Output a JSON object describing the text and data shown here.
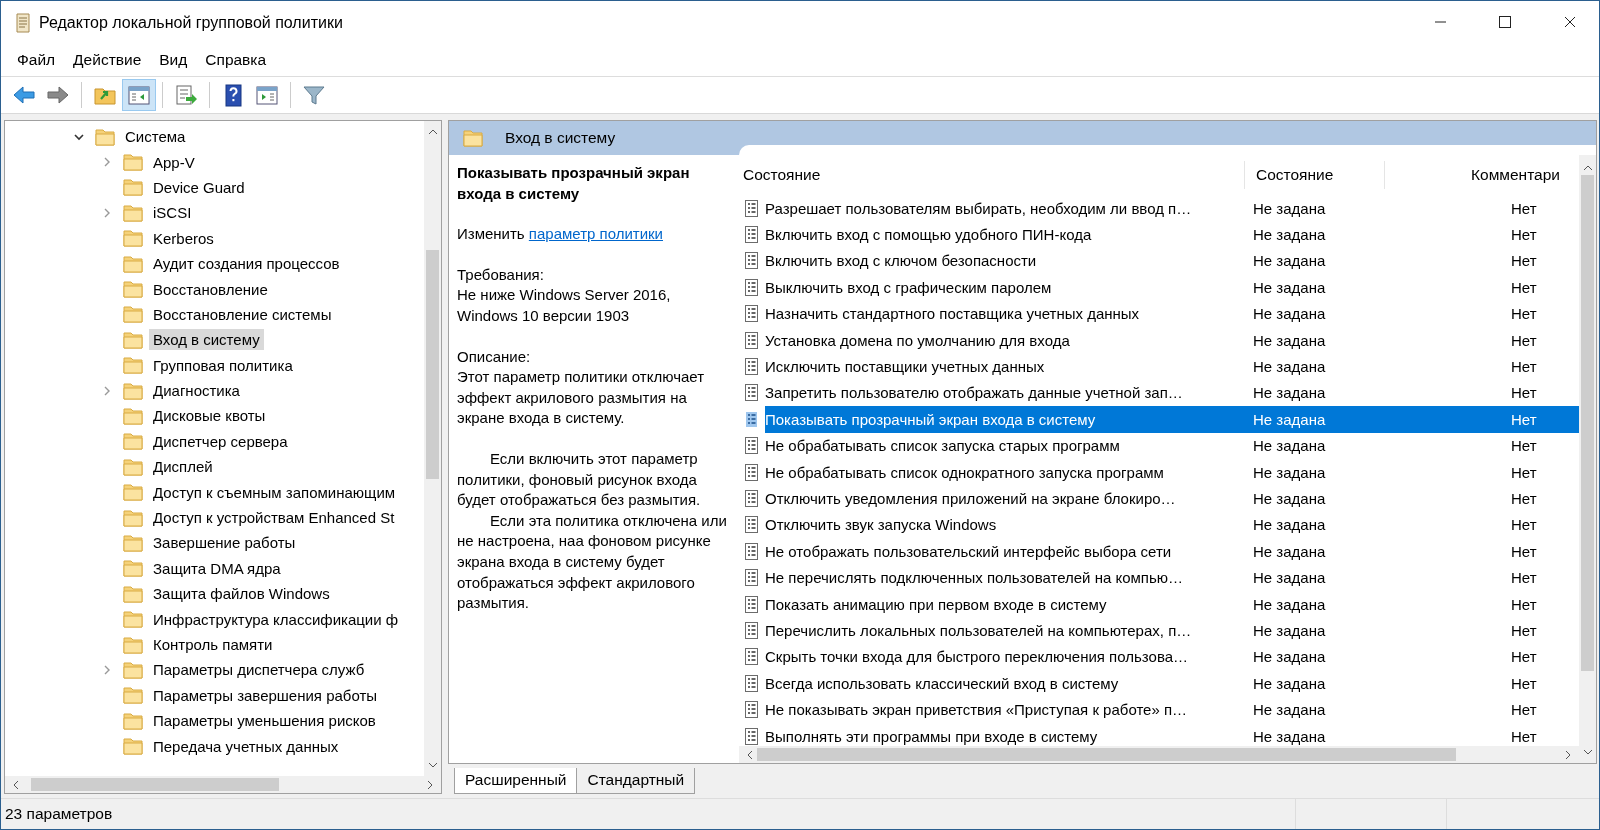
{
  "window": {
    "title": "Редактор локальной групповой политики"
  },
  "menu": [
    "Файл",
    "Действие",
    "Вид",
    "Справка"
  ],
  "toolbar": [
    [
      {
        "kind": "back",
        "pressed": false
      },
      {
        "kind": "forward",
        "pressed": false
      }
    ],
    [
      {
        "kind": "up",
        "pressed": false
      },
      {
        "kind": "tree",
        "pressed": true
      }
    ],
    [
      {
        "kind": "export",
        "pressed": false
      }
    ],
    [
      {
        "kind": "help",
        "pressed": false
      },
      {
        "kind": "panel",
        "pressed": false
      }
    ],
    [
      {
        "kind": "filter",
        "pressed": false
      }
    ]
  ],
  "tree": {
    "label": "Система",
    "expanded": true,
    "children": [
      {
        "label": "App-V",
        "expandable": true,
        "selected": false
      },
      {
        "label": "Device Guard",
        "expandable": false,
        "selected": false
      },
      {
        "label": "iSCSI",
        "expandable": true,
        "selected": false
      },
      {
        "label": "Kerberos",
        "expandable": false,
        "selected": false
      },
      {
        "label": "Аудит создания процессов",
        "expandable": false,
        "selected": false
      },
      {
        "label": "Восстановление",
        "expandable": false,
        "selected": false
      },
      {
        "label": "Восстановление системы",
        "expandable": false,
        "selected": false
      },
      {
        "label": "Вход в систему",
        "expandable": false,
        "selected": true
      },
      {
        "label": "Групповая политика",
        "expandable": false,
        "selected": false
      },
      {
        "label": "Диагностика",
        "expandable": true,
        "selected": false
      },
      {
        "label": "Дисковые квоты",
        "expandable": false,
        "selected": false
      },
      {
        "label": "Диспетчер сервера",
        "expandable": false,
        "selected": false
      },
      {
        "label": "Дисплей",
        "expandable": false,
        "selected": false
      },
      {
        "label": "Доступ к съемным запоминающим",
        "expandable": false,
        "selected": false
      },
      {
        "label": "Доступ к устройствам Enhanced St",
        "expandable": false,
        "selected": false
      },
      {
        "label": "Завершение работы",
        "expandable": false,
        "selected": false
      },
      {
        "label": "Защита DMA ядра",
        "expandable": false,
        "selected": false
      },
      {
        "label": "Защита файлов Windows",
        "expandable": false,
        "selected": false
      },
      {
        "label": "Инфраструктура классификации ф",
        "expandable": false,
        "selected": false
      },
      {
        "label": "Контроль памяти",
        "expandable": false,
        "selected": false
      },
      {
        "label": "Параметры диспетчера служб",
        "expandable": true,
        "selected": false
      },
      {
        "label": "Параметры завершения работы",
        "expandable": false,
        "selected": false
      },
      {
        "label": "Параметры уменьшения рисков",
        "expandable": false,
        "selected": false
      },
      {
        "label": "Передача учетных данных",
        "expandable": false,
        "selected": false
      }
    ]
  },
  "panel": {
    "title": "Вход в систему"
  },
  "details": {
    "title": "Показывать прозрачный экран входа в систему",
    "edit_prefix": "Изменить",
    "edit_link": "параметр политики",
    "requirements_label": "Требования:",
    "requirements": "Не ниже Windows Server 2016, Windows 10 версии 1903",
    "description_label": "Описание:",
    "paragraphs": [
      {
        "text": "Этот параметр политики отключает эффект акрилового размытия на экране входа в систему.",
        "indent": false
      },
      {
        "text": "Если включить этот параметр политики, фоновый рисунок входа будет отображаться без размытия.",
        "indent": true
      },
      {
        "text": "Если эта политика отключена или не настроена, наа фоновом рисунке экрана входа в систему будет отображаться эффект акрилового размытия.",
        "indent": true
      }
    ]
  },
  "table": {
    "columns": [
      "Состояние",
      "Состояние",
      "Комментари"
    ],
    "rows": [
      {
        "name": "Разрешает пользователям выбирать, необходим ли ввод п…",
        "state": "Не задана",
        "comment": "Нет",
        "selected": false
      },
      {
        "name": "Включить вход с помощью удобного ПИН-кода",
        "state": "Не задана",
        "comment": "Нет",
        "selected": false
      },
      {
        "name": "Включить вход с ключом безопасности",
        "state": "Не задана",
        "comment": "Нет",
        "selected": false
      },
      {
        "name": "Выключить вход с графическим паролем",
        "state": "Не задана",
        "comment": "Нет",
        "selected": false
      },
      {
        "name": "Назначить стандартного поставщика учетных данных",
        "state": "Не задана",
        "comment": "Нет",
        "selected": false
      },
      {
        "name": "Установка домена по умолчанию для входа",
        "state": "Не задана",
        "comment": "Нет",
        "selected": false
      },
      {
        "name": "Исключить поставщики учетных данных",
        "state": "Не задана",
        "comment": "Нет",
        "selected": false
      },
      {
        "name": "Запретить пользователю отображать данные учетной зап…",
        "state": "Не задана",
        "comment": "Нет",
        "selected": false
      },
      {
        "name": "Показывать прозрачный экран входа в систему",
        "state": "Не задана",
        "comment": "Нет",
        "selected": true
      },
      {
        "name": "Не обрабатывать список запуска старых программ",
        "state": "Не задана",
        "comment": "Нет",
        "selected": false
      },
      {
        "name": "Не обрабатывать список однократного запуска программ",
        "state": "Не задана",
        "comment": "Нет",
        "selected": false
      },
      {
        "name": "Отключить уведомления приложений на экране блокиро…",
        "state": "Не задана",
        "comment": "Нет",
        "selected": false
      },
      {
        "name": "Отключить звук запуска Windows",
        "state": "Не задана",
        "comment": "Нет",
        "selected": false
      },
      {
        "name": "Не отображать пользовательский интерфейс выбора сети",
        "state": "Не задана",
        "comment": "Нет",
        "selected": false
      },
      {
        "name": "Не перечислять подключенных пользователей на компью…",
        "state": "Не задана",
        "comment": "Нет",
        "selected": false
      },
      {
        "name": "Показать анимацию при первом входе в систему",
        "state": "Не задана",
        "comment": "Нет",
        "selected": false
      },
      {
        "name": "Перечислить локальных пользователей на компьютерах, п…",
        "state": "Не задана",
        "comment": "Нет",
        "selected": false
      },
      {
        "name": "Скрыть точки входа для быстрого переключения пользова…",
        "state": "Не задана",
        "comment": "Нет",
        "selected": false
      },
      {
        "name": "Всегда использовать классический вход в систему",
        "state": "Не задана",
        "comment": "Нет",
        "selected": false
      },
      {
        "name": "Не показывать экран приветствия «Приступая к работе» п…",
        "state": "Не задана",
        "comment": "Нет",
        "selected": false
      },
      {
        "name": "Выполнять эти программы при входе в систему",
        "state": "Не задана",
        "comment": "Нет",
        "selected": false
      }
    ]
  },
  "view_tabs": [
    {
      "label": "Расширенный",
      "selected": true
    },
    {
      "label": "Стандартный",
      "selected": false
    }
  ],
  "status_bar": {
    "text": "23 параметров"
  }
}
